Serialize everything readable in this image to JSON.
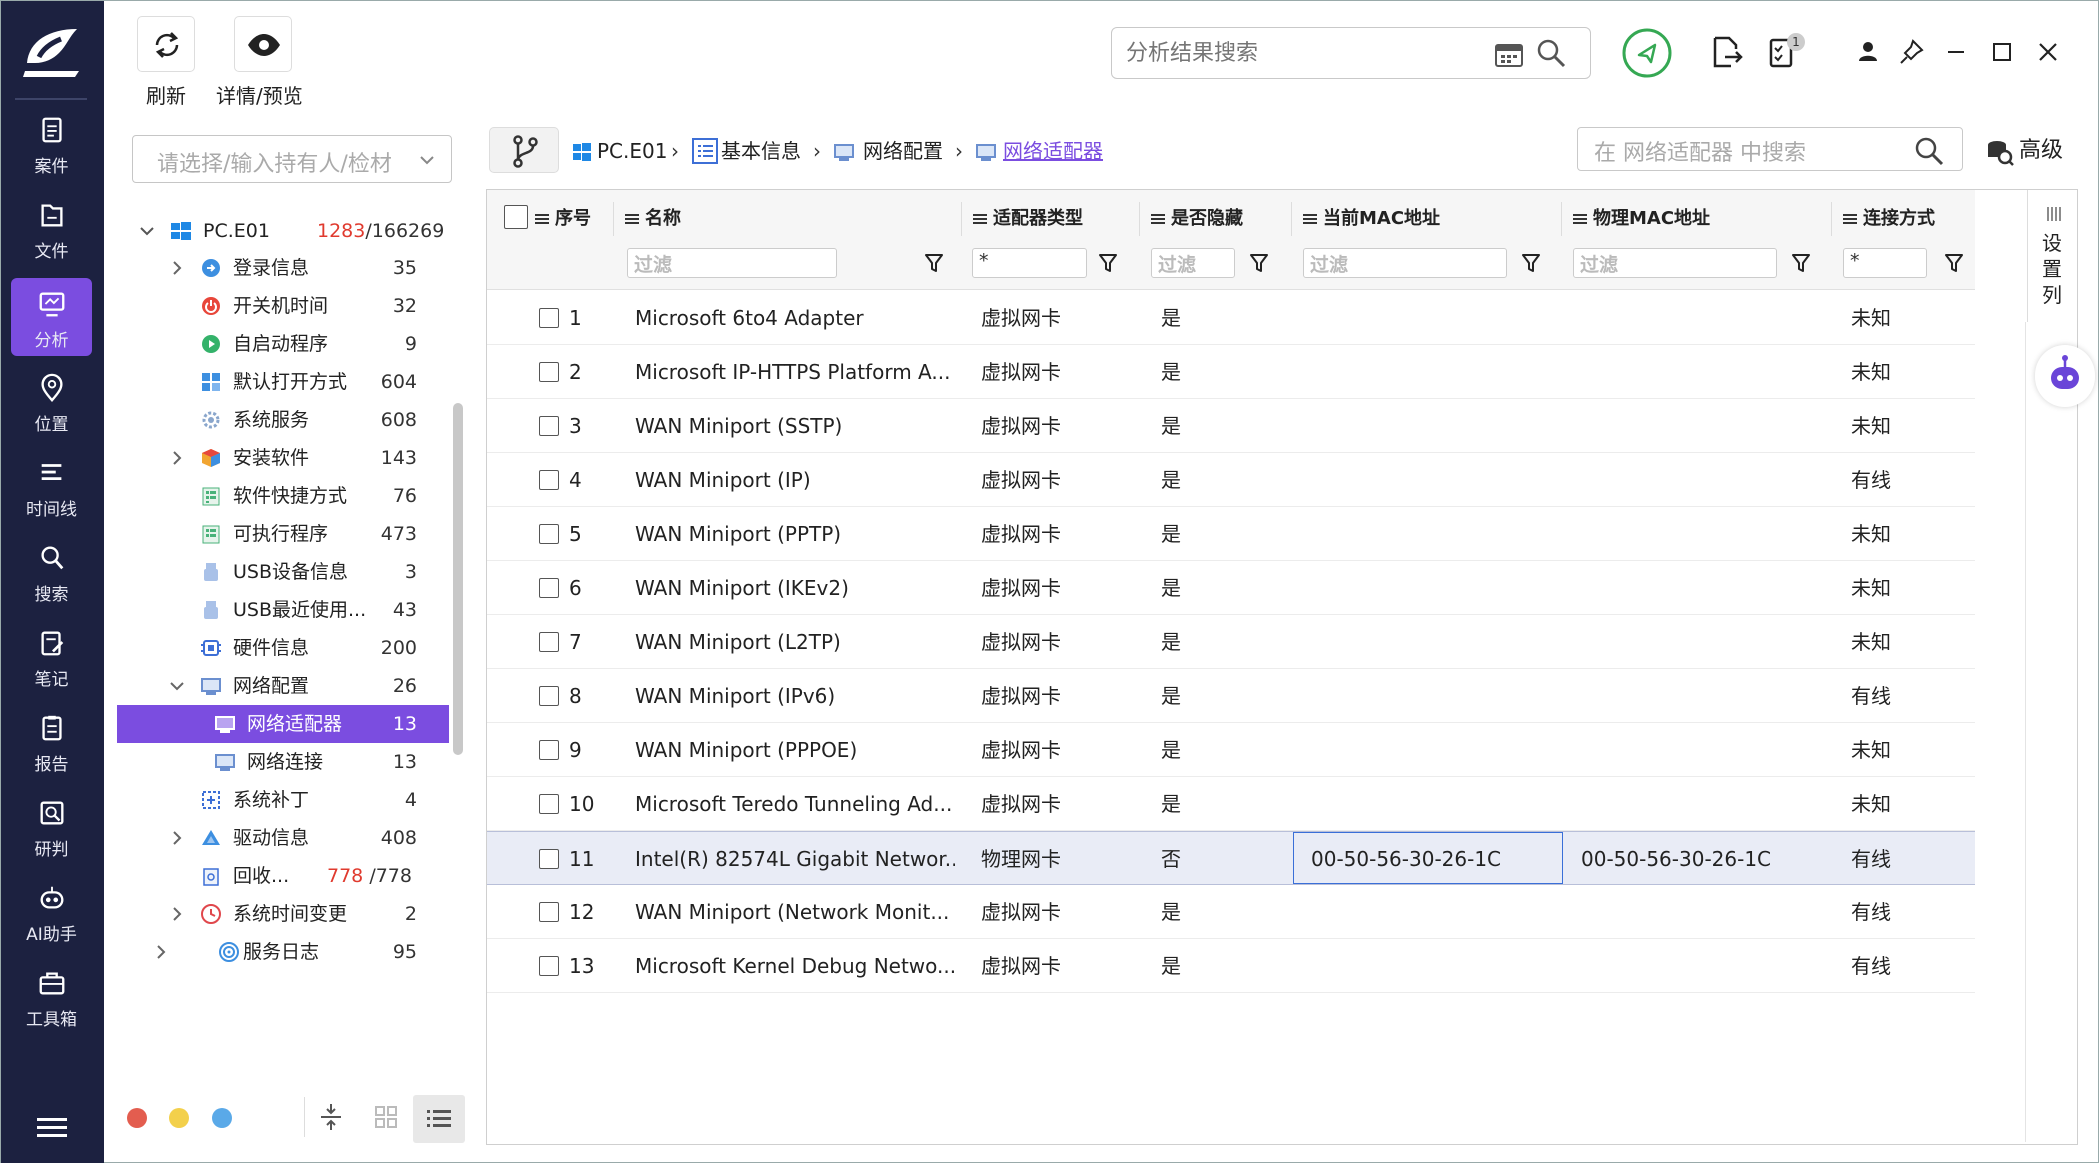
{
  "nav": {
    "items": [
      {
        "label": "案件",
        "icon": "case-icon"
      },
      {
        "label": "文件",
        "icon": "file-icon"
      },
      {
        "label": "分析",
        "icon": "analysis-icon",
        "active": true
      },
      {
        "label": "位置",
        "icon": "location-icon"
      },
      {
        "label": "时间线",
        "icon": "timeline-icon"
      },
      {
        "label": "搜索",
        "icon": "search-icon"
      },
      {
        "label": "笔记",
        "icon": "note-icon"
      },
      {
        "label": "报告",
        "icon": "report-icon"
      },
      {
        "label": "研判",
        "icon": "judge-icon"
      },
      {
        "label": "AI助手",
        "icon": "ai-assistant-icon"
      },
      {
        "label": "工具箱",
        "icon": "toolbox-icon"
      }
    ]
  },
  "toolbar": {
    "refresh_label": "刷新",
    "detail_label": "详情/预览"
  },
  "top_search": {
    "placeholder": "分析结果搜索"
  },
  "badges": {
    "tasks": "1"
  },
  "owner_select": {
    "placeholder": "请选择/输入持有人/检材"
  },
  "tree": {
    "root": {
      "label": "PC.E01",
      "count_red": "1283",
      "count_total": "/166269"
    },
    "items": [
      {
        "label": "登录信息",
        "count": "35",
        "icon": "login-icon",
        "expandable": true
      },
      {
        "label": "开关机时间",
        "count": "32",
        "icon": "power-icon"
      },
      {
        "label": "自启动程序",
        "count": "9",
        "icon": "autostart-icon"
      },
      {
        "label": "默认打开方式",
        "count": "604",
        "icon": "default-open-icon"
      },
      {
        "label": "系统服务",
        "count": "608",
        "icon": "service-gear-icon"
      },
      {
        "label": "安装软件",
        "count": "143",
        "icon": "installed-software-icon",
        "expandable": true
      },
      {
        "label": "软件快捷方式",
        "count": "76",
        "icon": "shortcut-icon"
      },
      {
        "label": "可执行程序",
        "count": "473",
        "icon": "executable-icon"
      },
      {
        "label": "USB设备信息",
        "count": "3",
        "icon": "usb-icon"
      },
      {
        "label": "USB最近使用...",
        "count": "43",
        "icon": "usb-recent-icon"
      },
      {
        "label": "硬件信息",
        "count": "200",
        "icon": "hardware-chip-icon"
      },
      {
        "label": "网络配置",
        "count": "26",
        "icon": "network-config-icon",
        "expanded": true
      },
      {
        "label": "网络适配器",
        "count": "13",
        "icon": "network-adapter-icon",
        "selected": true
      },
      {
        "label": "网络连接",
        "count": "13",
        "icon": "network-connection-icon"
      },
      {
        "label": "系统补丁",
        "count": "4",
        "icon": "patch-icon"
      },
      {
        "label": "驱动信息",
        "count": "408",
        "icon": "driver-icon",
        "expandable": true
      },
      {
        "label": "回收...",
        "count_red": "778",
        "count_total": "/778",
        "icon": "recycle-bin-icon"
      },
      {
        "label": "系统时间变更",
        "count": "2",
        "icon": "clock-change-icon",
        "expandable": true
      },
      {
        "label": "服务日志",
        "count": "95",
        "icon": "service-log-icon",
        "expandable": true
      }
    ]
  },
  "colors": {
    "accent": "#7b4de0",
    "nav_bg": "#1c2140",
    "dot_red": "#e35d4f",
    "dot_yellow": "#f3d04b",
    "dot_blue": "#5aa9e8",
    "green": "#35a853"
  },
  "breadcrumb": [
    "PC.E01",
    "基本信息",
    "网络配置",
    "网络适配器"
  ],
  "table_search": {
    "placeholder": "在 网络适配器 中搜索"
  },
  "advanced_label": "高级",
  "settings_col_label": "设置列",
  "table": {
    "columns": [
      "序号",
      "名称",
      "适配器类型",
      "是否隐藏",
      "当前MAC地址",
      "物理MAC地址",
      "连接方式"
    ],
    "filters": [
      "过滤",
      "*",
      "过滤",
      "过滤",
      "过滤",
      "*"
    ],
    "rows": [
      {
        "no": "1",
        "name": "Microsoft 6to4 Adapter",
        "type": "虚拟网卡",
        "hidden": "是",
        "cur_mac": "",
        "phy_mac": "",
        "conn": "未知"
      },
      {
        "no": "2",
        "name": "Microsoft IP-HTTPS Platform A...",
        "type": "虚拟网卡",
        "hidden": "是",
        "cur_mac": "",
        "phy_mac": "",
        "conn": "未知"
      },
      {
        "no": "3",
        "name": "WAN Miniport (SSTP)",
        "type": "虚拟网卡",
        "hidden": "是",
        "cur_mac": "",
        "phy_mac": "",
        "conn": "未知"
      },
      {
        "no": "4",
        "name": "WAN Miniport (IP)",
        "type": "虚拟网卡",
        "hidden": "是",
        "cur_mac": "",
        "phy_mac": "",
        "conn": "有线"
      },
      {
        "no": "5",
        "name": "WAN Miniport (PPTP)",
        "type": "虚拟网卡",
        "hidden": "是",
        "cur_mac": "",
        "phy_mac": "",
        "conn": "未知"
      },
      {
        "no": "6",
        "name": "WAN Miniport (IKEv2)",
        "type": "虚拟网卡",
        "hidden": "是",
        "cur_mac": "",
        "phy_mac": "",
        "conn": "未知"
      },
      {
        "no": "7",
        "name": "WAN Miniport (L2TP)",
        "type": "虚拟网卡",
        "hidden": "是",
        "cur_mac": "",
        "phy_mac": "",
        "conn": "未知"
      },
      {
        "no": "8",
        "name": "WAN Miniport (IPv6)",
        "type": "虚拟网卡",
        "hidden": "是",
        "cur_mac": "",
        "phy_mac": "",
        "conn": "有线"
      },
      {
        "no": "9",
        "name": "WAN Miniport (PPPOE)",
        "type": "虚拟网卡",
        "hidden": "是",
        "cur_mac": "",
        "phy_mac": "",
        "conn": "未知"
      },
      {
        "no": "10",
        "name": "Microsoft Teredo Tunneling Ad...",
        "type": "虚拟网卡",
        "hidden": "是",
        "cur_mac": "",
        "phy_mac": "",
        "conn": "未知"
      },
      {
        "no": "11",
        "name": "Intel(R) 82574L Gigabit Networ...",
        "type": "物理网卡",
        "hidden": "否",
        "cur_mac": "00-50-56-30-26-1C",
        "phy_mac": "00-50-56-30-26-1C",
        "conn": "有线",
        "selected": true
      },
      {
        "no": "12",
        "name": "WAN Miniport (Network Monit...",
        "type": "虚拟网卡",
        "hidden": "是",
        "cur_mac": "",
        "phy_mac": "",
        "conn": "有线"
      },
      {
        "no": "13",
        "name": "Microsoft Kernel Debug Netwo...",
        "type": "虚拟网卡",
        "hidden": "是",
        "cur_mac": "",
        "phy_mac": "",
        "conn": "有线"
      }
    ]
  }
}
